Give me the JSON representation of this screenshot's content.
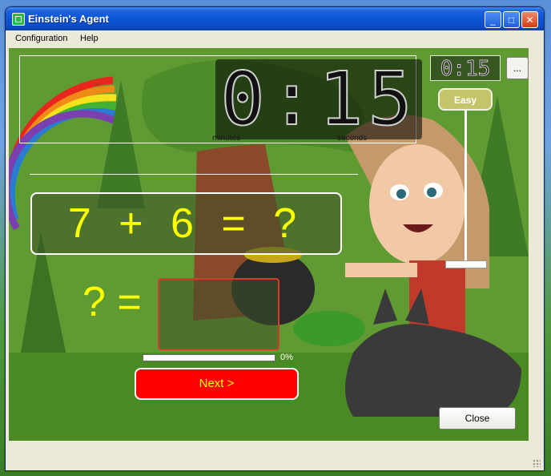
{
  "window": {
    "title": "Einstein's Agent",
    "controls": {
      "minimize": "_",
      "maximize": "□",
      "close": "✕"
    }
  },
  "menu": {
    "items": [
      "Configuration",
      "Help"
    ]
  },
  "timer": {
    "big": "0:15",
    "small": "0:15",
    "minutes_label": "minutes",
    "seconds_label": "seconds"
  },
  "settings_button": "...",
  "difficulty": {
    "label": "Easy",
    "level_fraction": 0.98
  },
  "question": {
    "text": "7 + 6 = ?"
  },
  "answer": {
    "label": "? =",
    "value": ""
  },
  "progress": {
    "value_percent": 0,
    "label": "0%"
  },
  "buttons": {
    "next": "Next >",
    "close": "Close"
  },
  "colors": {
    "accent_yellow": "#ffff00",
    "next_red": "#ff0000",
    "xp_blue": "#0a55d6"
  }
}
